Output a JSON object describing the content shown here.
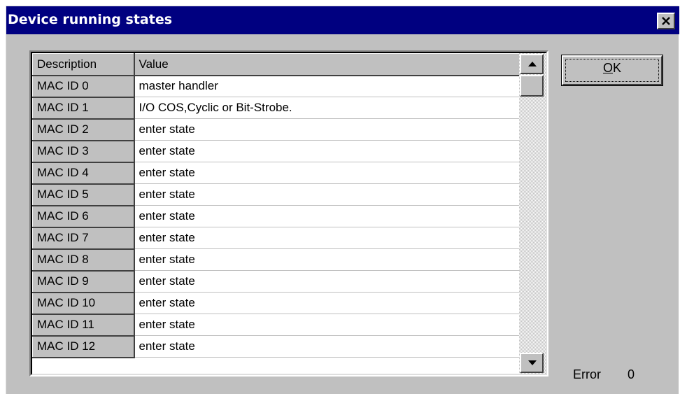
{
  "window": {
    "title": "Device running states"
  },
  "grid": {
    "columns": [
      "Description",
      "Value"
    ],
    "rows": [
      {
        "description": "MAC ID 0",
        "value": "master handler"
      },
      {
        "description": "MAC ID 1",
        "value": "I/O COS,Cyclic or Bit-Strobe."
      },
      {
        "description": "MAC ID 2",
        "value": "enter state"
      },
      {
        "description": "MAC ID 3",
        "value": "enter state"
      },
      {
        "description": "MAC ID 4",
        "value": "enter state"
      },
      {
        "description": "MAC ID 5",
        "value": "enter state"
      },
      {
        "description": "MAC ID 6",
        "value": "enter state"
      },
      {
        "description": "MAC ID 7",
        "value": "enter state"
      },
      {
        "description": "MAC ID 8",
        "value": "enter state"
      },
      {
        "description": "MAC ID 9",
        "value": "enter state"
      },
      {
        "description": "MAC ID 10",
        "value": "enter state"
      },
      {
        "description": "MAC ID 11",
        "value": "enter state"
      },
      {
        "description": "MAC ID 12",
        "value": "enter state"
      }
    ]
  },
  "ok_button": {
    "accel": "O",
    "rest": "K"
  },
  "status": {
    "error_label": "Error",
    "error_value": "0"
  },
  "colors": {
    "titlebar": "#000080",
    "face": "#c0c0c0"
  }
}
